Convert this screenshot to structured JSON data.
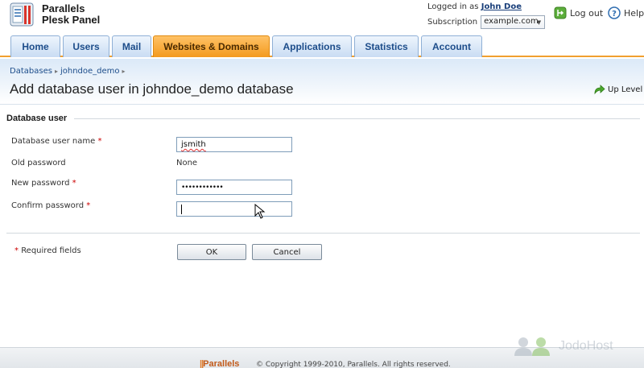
{
  "header": {
    "logo_line1": "Parallels",
    "logo_line2": "Plesk Panel",
    "logged_in_prefix": "Logged in as",
    "user_name": "John Doe",
    "subscription_label": "Subscription",
    "subscription_value": "example.com",
    "logout_label": "Log out",
    "help_label": "Help"
  },
  "tabs": [
    {
      "label": "Home"
    },
    {
      "label": "Users"
    },
    {
      "label": "Mail"
    },
    {
      "label": "Websites & Domains",
      "active": true
    },
    {
      "label": "Applications"
    },
    {
      "label": "Statistics"
    },
    {
      "label": "Account"
    }
  ],
  "breadcrumb": [
    "Databases",
    "johndoe_demo"
  ],
  "page_title": "Add database user in johndoe_demo database",
  "up_level_label": "Up Level",
  "form": {
    "section_title": "Database user",
    "username_label": "Database user name",
    "username_value": "jsmith",
    "old_password_label": "Old password",
    "old_password_value": "None",
    "new_password_label": "New password",
    "new_password_value": "••••••••••••",
    "confirm_password_label": "Confirm password",
    "confirm_password_value": "",
    "required_marker": "*"
  },
  "required_note": "Required fields",
  "buttons": {
    "ok": "OK",
    "cancel": "Cancel"
  },
  "footer": {
    "brand": "Parallels",
    "copyright": "© Copyright 1999-2010, Parallels. All rights reserved."
  },
  "watermark": "JodoHost",
  "colors": {
    "active_tab": "#f39a1e",
    "tab": "#c9dcf3",
    "accent_rule": "#f0a030",
    "required": "#cc0000",
    "link": "#1d4d8a"
  }
}
